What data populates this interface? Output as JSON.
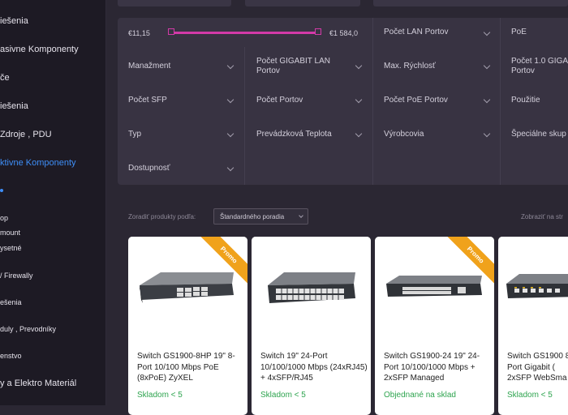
{
  "sidebar": {
    "items": [
      {
        "label": "iešenia"
      },
      {
        "label": "asivne Komponenty"
      },
      {
        "label": "če"
      },
      {
        "label": "iešenia"
      },
      {
        "label": "Zdroje , PDU"
      },
      {
        "label": "ktivne Komponenty"
      },
      {
        "label": "op"
      },
      {
        "label": "mount"
      },
      {
        "label": "ysetné"
      },
      {
        "label": "/ Firewally"
      },
      {
        "label": "ešenia"
      },
      {
        "label": "duly , Prevodníky"
      },
      {
        "label": "enstvo"
      },
      {
        "label": "y a Elektro Materiál"
      }
    ]
  },
  "filters": {
    "price_min": "€11,15",
    "price_max": "€1 584,0",
    "price_range_fraction": [
      0.0,
      1.0
    ],
    "cells": [
      {
        "label": "Počet LAN Portov"
      },
      {
        "label": "PoE"
      },
      {
        "label": "Manažment"
      },
      {
        "label": "Počet GIGABIT LAN Portov"
      },
      {
        "label": "Max. Rýchlosť"
      },
      {
        "label": "Počet 1.0 GIGA Portov"
      },
      {
        "label": "Počet SFP"
      },
      {
        "label": "Počet Portov"
      },
      {
        "label": "Počet PoE Portov"
      },
      {
        "label": "Použitie"
      },
      {
        "label": "Typ"
      },
      {
        "label": "Prevádzková Teplota"
      },
      {
        "label": "Výrobcovia"
      },
      {
        "label": "Špeciálne skup"
      },
      {
        "label": "Dostupnosť"
      }
    ]
  },
  "sort": {
    "label": "Zoradiť produkty podľa:",
    "selected": "Štandardného poradia",
    "display_label": "Zobraziť na str"
  },
  "products": [
    {
      "title": "Switch GS1900-8HP 19\" 8-Port 10/100 Mbps PoE (8xPoE) ZyXEL",
      "stock": "Skladom < 5",
      "stock_color": "#2ea44f",
      "promo": "Promo"
    },
    {
      "title": "Switch 19\" 24-Port 10/100/1000 Mbps (24xRJ45) + 4xSFP/RJ45",
      "stock": "Skladom < 5",
      "stock_color": "#2ea44f",
      "promo": ""
    },
    {
      "title": "Switch GS1900-24 19\" 24-Port 10/100/1000 Mbps + 2xSFP Managed",
      "stock": "Objednané na sklad",
      "stock_color": "#2ea44f",
      "promo": "Promo"
    },
    {
      "title": "Switch GS1900 8-Port Gigabit ( 2xSFP WebSma",
      "stock": "Skladom < 5",
      "stock_color": "#2ea44f",
      "promo": ""
    }
  ],
  "colors": {
    "accent": "#3e8ef7",
    "range": "#d33aa8",
    "promo": "#f0a21b",
    "in_stock": "#2ea44f"
  }
}
